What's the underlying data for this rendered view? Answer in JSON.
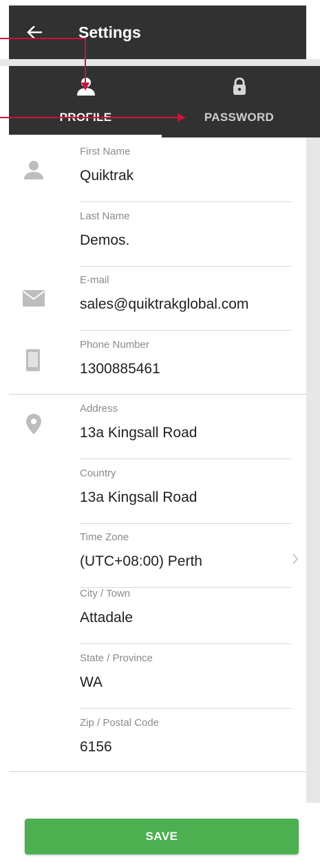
{
  "header": {
    "title": "Settings",
    "back_icon": "arrow-left-icon"
  },
  "tabs": [
    {
      "label": "PROFILE",
      "icon": "person-icon",
      "active": true
    },
    {
      "label": "PASSWORD",
      "icon": "lock-icon",
      "active": false
    }
  ],
  "form": {
    "fields": [
      {
        "label": "First Name",
        "value": "Quiktrak"
      },
      {
        "label": "Last Name",
        "value": "Demos."
      },
      {
        "label": "E-mail",
        "value": "sales@quiktrakglobal.com"
      },
      {
        "label": "Phone Number",
        "value": "1300885461"
      },
      {
        "label": "Address",
        "value": "13a Kingsall Road"
      },
      {
        "label": "Country",
        "value": "13a Kingsall Road"
      },
      {
        "label": "Time Zone",
        "value": "(UTC+08:00) Perth"
      },
      {
        "label": "City / Town",
        "value": "Attadale"
      },
      {
        "label": "State / Province",
        "value": "WA"
      },
      {
        "label": "Zip / Postal Code",
        "value": "6156"
      }
    ],
    "section_icons": [
      "person-icon",
      "mail-icon",
      "phone-icon",
      "location-pin-icon"
    ],
    "time_zone_icon": "chevron-right-icon"
  },
  "save": {
    "label": "SAVE"
  },
  "colors": {
    "header_bg": "#313131",
    "save_green": "#4caf50",
    "annotation_red": "#d0103a",
    "icon_grey": "#bdbdbd"
  }
}
